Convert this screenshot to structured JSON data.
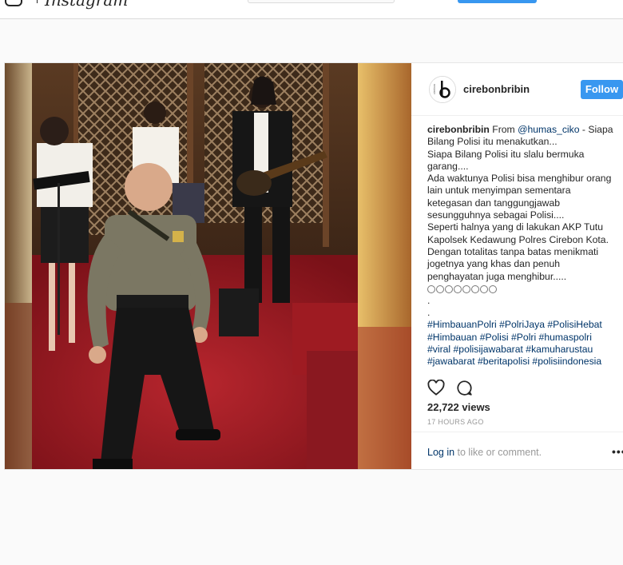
{
  "header": {
    "search_placeholder": ""
  },
  "post": {
    "username": "cirebonbribin",
    "follow_label": "Follow",
    "caption": {
      "author": "cirebonbribin",
      "from_word": "From",
      "mention": "@humas_ciko",
      "lines": [
        "Bilang Polisi itu menakutkan...",
        "Siapa Bilang Polisi itu slalu bermuka",
        "garang....",
        "Ada waktunya Polisi bisa menghibur orang",
        "lain untuk menyimpan sementara",
        "ketegasan dan tanggungjawab",
        "sesungguhnya sebagai Polisi....",
        "Seperti halnya yang di lakukan AKP Tutu",
        "Kapolsek Kedawung Polres Cirebon Kota.",
        "Dengan totalitas tanpa batas menikmati",
        "jogetnya yang khas dan penuh",
        "penghayatan juga menghibur....."
      ],
      "first_line_rest": " - Siapa",
      "dots": [
        ".",
        "."
      ],
      "hashtag_lines": [
        "#HimbauanPolri #PolriJaya #PolisiHebat",
        "#Himbauan #Polisi #Polri #humaspolri",
        "#viral #polisijawabarat #kamuharustau",
        "#jawabarat #beritapolisi #polisiindonesia"
      ]
    },
    "views": "22,722 views",
    "timestamp": "17 HOURS AGO",
    "login_link": "Log in",
    "login_rest": " to like or comment.",
    "more_label": "•••",
    "icons": {
      "like": "heart-icon",
      "comment": "comment-bubble-icon",
      "more": "more-options-icon"
    },
    "colors": {
      "accent": "#3897f0",
      "link": "#003569",
      "muted": "#999999"
    }
  }
}
